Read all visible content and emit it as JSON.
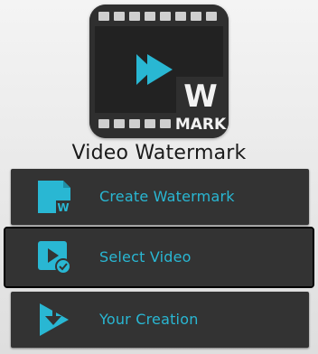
{
  "app": {
    "title": "Video Watermark",
    "logo_letter": "W",
    "logo_word": "MARK"
  },
  "menu": [
    {
      "label": "Create Watermark",
      "icon": "watermark-doc-icon",
      "icon_letter": "W"
    },
    {
      "label": "Select Video",
      "icon": "video-check-icon",
      "selected": true
    },
    {
      "label": "Your Creation",
      "icon": "play-download-icon"
    }
  ],
  "colors": {
    "accent": "#29b7d3",
    "button_bg": "#333333",
    "background": "#ebebeb"
  }
}
